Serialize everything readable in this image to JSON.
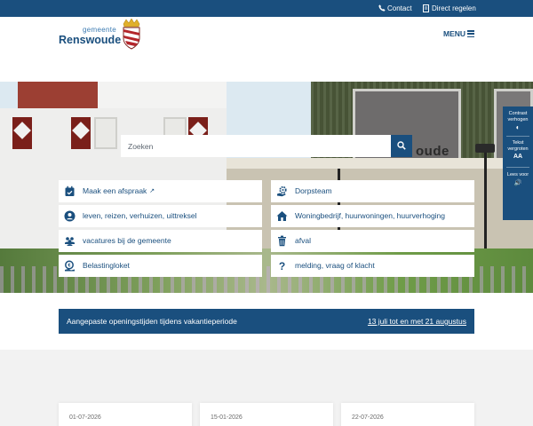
{
  "topbar": {
    "contact_label": "Contact",
    "direct_label": "Direct regelen"
  },
  "header": {
    "logo_small": "gemeente",
    "logo_main": "Renswoude",
    "menu_label": "MENU"
  },
  "hero": {
    "building_sign_text": "oude"
  },
  "accessibility": {
    "contrast_label": "Contrast verhogen",
    "contrast_icon": "◐",
    "text_label": "Tekst vergroten",
    "text_icon": "AA",
    "read_label": "Lees voor",
    "read_icon": "🔊"
  },
  "search": {
    "placeholder": "Zoeken"
  },
  "tiles": [
    {
      "label": "Maak een afspraak",
      "icon": "calendar-check-icon",
      "external": true
    },
    {
      "label": "Dorpsteam",
      "icon": "gear-hand-icon",
      "external": false
    },
    {
      "label": "leven, reizen, verhuizen, uittreksel",
      "icon": "user-circle-icon",
      "external": false
    },
    {
      "label": "Woningbedrijf, huurwoningen, huurverhoging",
      "icon": "house-icon",
      "external": false
    },
    {
      "label": "vacatures bij de gemeente",
      "icon": "people-icon",
      "external": false
    },
    {
      "label": "afval",
      "icon": "trash-icon",
      "external": false
    },
    {
      "label": "Belastingloket",
      "icon": "tax-icon",
      "external": false
    },
    {
      "label": "melding, vraag of klacht",
      "icon": "question-icon",
      "external": false
    }
  ],
  "notice": {
    "message": "Aangepaste openingstijden tijdens vakantieperiode",
    "dates_link": "13 juli tot en met 21 augustus"
  },
  "news": [
    {
      "date": "01-07-2026"
    },
    {
      "date": "15-01-2026"
    },
    {
      "date": "22-07-2026"
    }
  ],
  "colors": {
    "brand": "#1a4f7e",
    "link": "#1a4f7e",
    "background_grey": "#f2f2f2"
  }
}
